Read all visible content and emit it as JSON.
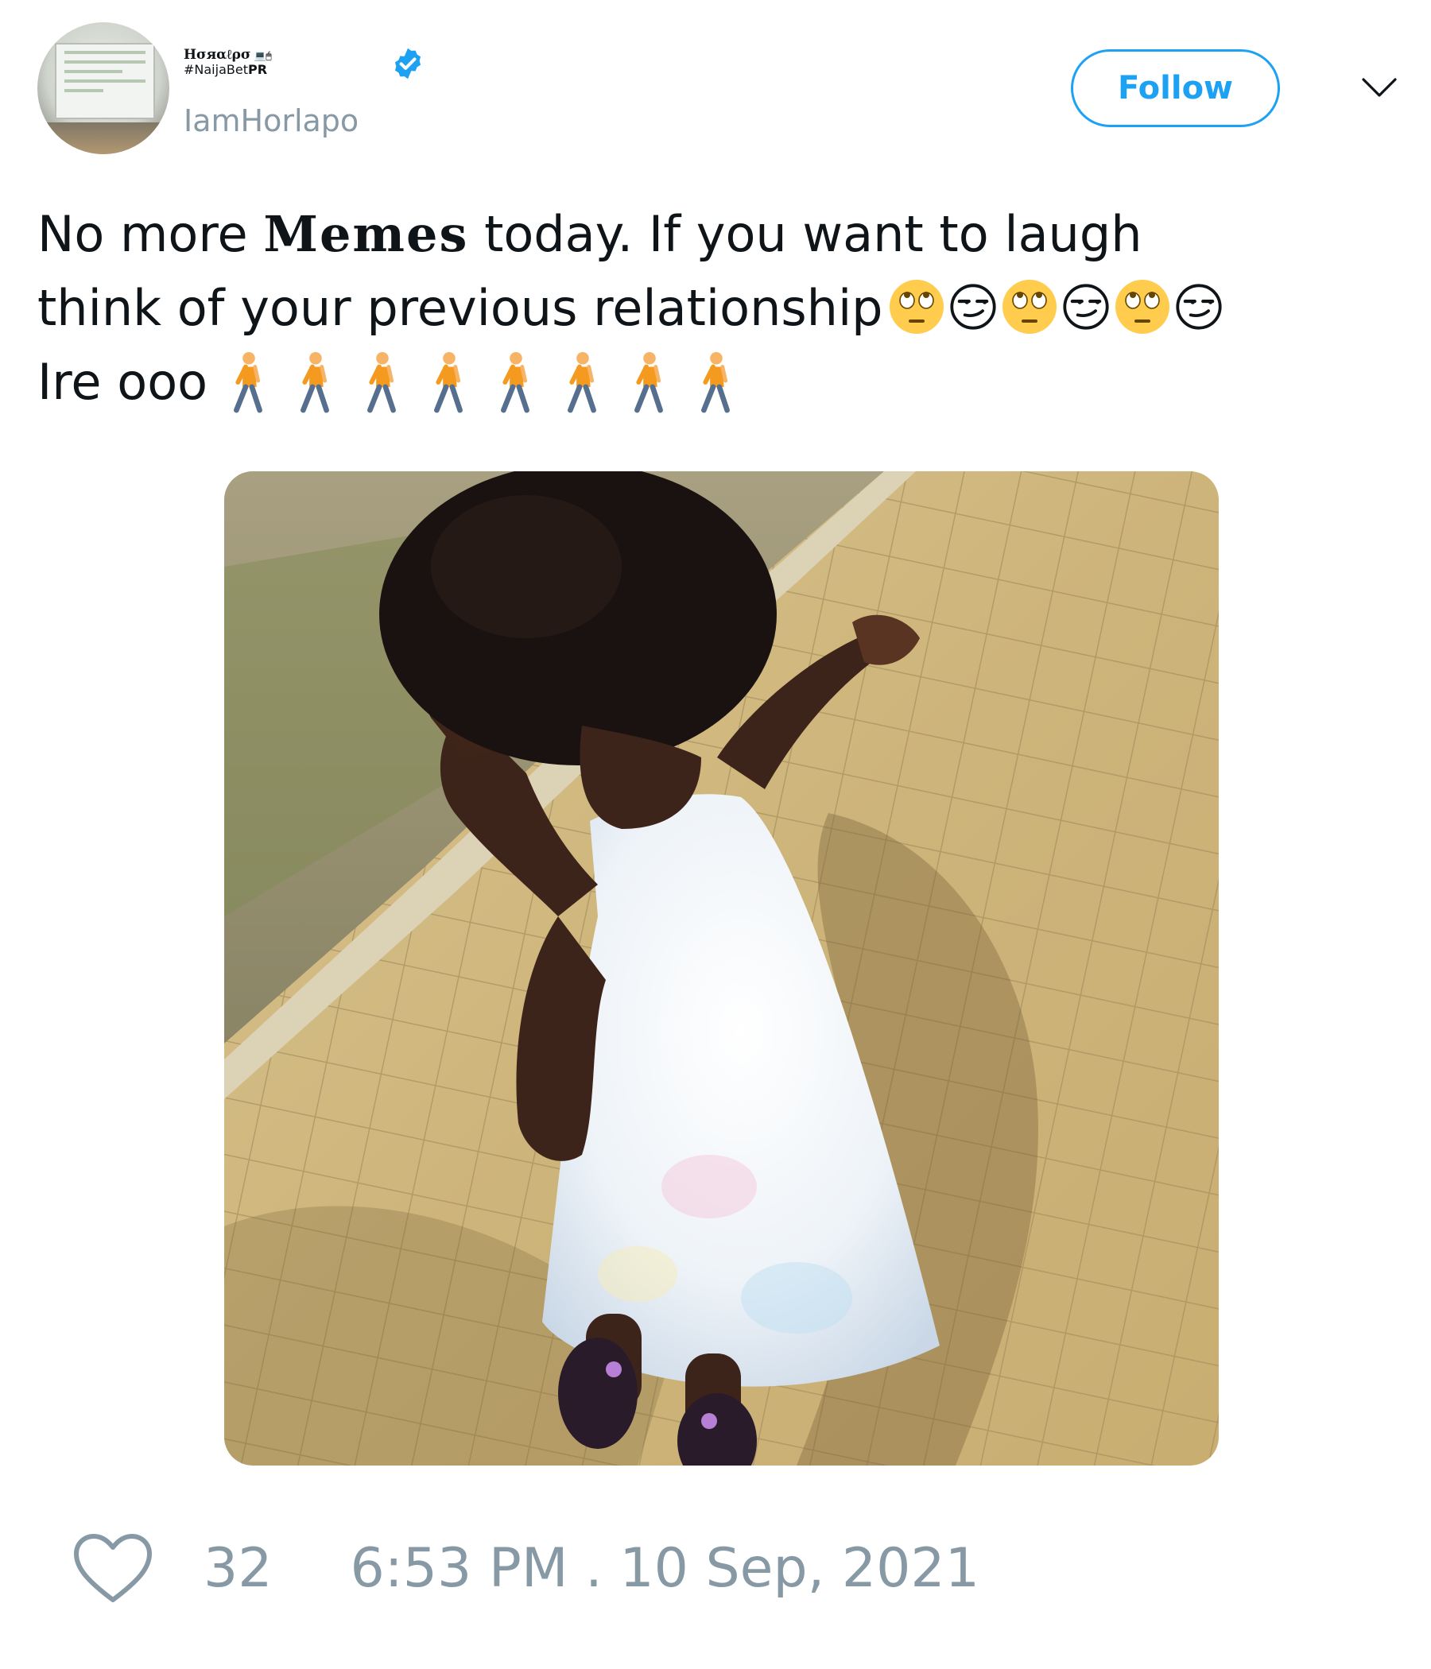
{
  "author": {
    "display_name": "Hσяαℓρσ",
    "display_icons": "💻🖱",
    "tag_prefix": "#NaijaBet",
    "tag_bold": "PR",
    "handle": "IamHorlapo",
    "verified": true,
    "verified_color": "#1da1f2"
  },
  "header": {
    "follow_label": "Follow",
    "menu_icon": "chevron-down-icon"
  },
  "tweet": {
    "text_part1": "No more ",
    "bold_word": "Memes",
    "text_part2": " today. If you want to laugh",
    "text_line2": "think of your previous relationship",
    "line2_emojis": [
      "face-with-rolling-eyes",
      "smirking-face",
      "face-with-rolling-eyes",
      "smirking-face",
      "face-with-rolling-eyes",
      "smirking-face"
    ],
    "text_line3": "Ire ooo",
    "line3_emojis": [
      "person-walking",
      "person-walking",
      "person-walking",
      "person-walking",
      "person-walking",
      "person-walking",
      "person-walking",
      "person-walking"
    ]
  },
  "media": {
    "type": "photo"
  },
  "footer": {
    "like_icon": "heart-icon",
    "like_count": "32",
    "timestamp": "6:53 PM . 10 Sep, 2021"
  },
  "colors": {
    "accent": "#1da1f2",
    "muted": "#8899a6",
    "text": "#0f1419"
  }
}
